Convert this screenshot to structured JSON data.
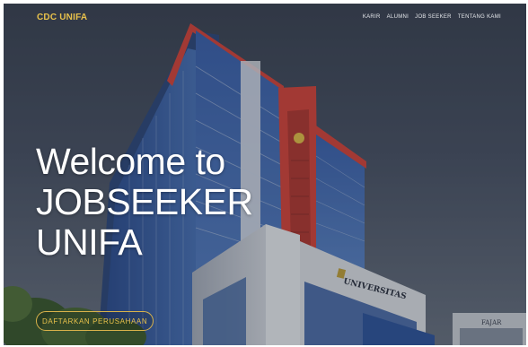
{
  "navbar": {
    "brand": "CDC UNIFA",
    "links": [
      "KARIR",
      "ALUMNI",
      "JOB SEEKER",
      "TENTANG KAMI"
    ]
  },
  "hero": {
    "lines": [
      "Welcome to",
      "JOBSEEKER",
      "UNIFA"
    ],
    "cta_label": "DAFTARKAN PERUSAHAAN"
  },
  "background": {
    "building_sign": "UNIVERSITAS",
    "side_sign": "FAJAR"
  },
  "colors": {
    "accent": "#e8c14b",
    "building_red": "#d8463c",
    "glass_blue": "#3f69b8"
  }
}
